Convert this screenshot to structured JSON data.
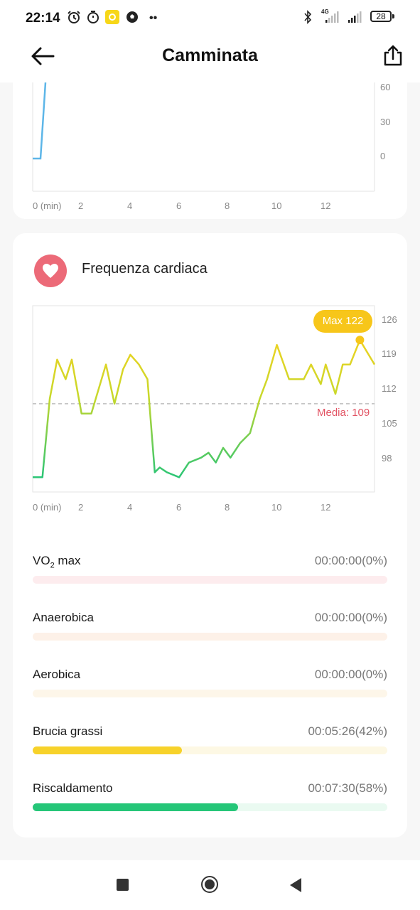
{
  "status_bar": {
    "time": "22:14",
    "battery": "28",
    "network": "4G",
    "icons": [
      "alarm-icon",
      "timer-icon",
      "app-notification-icon",
      "soccer-ball-icon",
      "more-dots-icon",
      "bluetooth-icon",
      "signal-icon",
      "battery-icon"
    ]
  },
  "header": {
    "title": "Camminata",
    "back_icon": "back-arrow-icon",
    "share_icon": "share-icon"
  },
  "top_chart": {
    "y_ticks": [
      "60",
      "30",
      "0"
    ],
    "x_ticks": [
      "0 (min)",
      "2",
      "4",
      "6",
      "8",
      "10",
      "12"
    ],
    "line_color": "#5db6e8"
  },
  "heart_rate": {
    "title": "Frequenza cardiaca",
    "max_label": "Max 122",
    "average_label": "Media: 109",
    "average": 109,
    "max": 122,
    "y_ticks": [
      "126",
      "119",
      "112",
      "105",
      "98"
    ],
    "x_ticks": [
      "0 (min)",
      "2",
      "4",
      "6",
      "8",
      "10",
      "12"
    ],
    "chart_data": {
      "type": "line",
      "xlabel": "min",
      "ylim": [
        91,
        129
      ],
      "xlim": [
        0,
        14
      ],
      "x": [
        0,
        0.4,
        0.7,
        1.0,
        1.35,
        1.6,
        2.0,
        2.4,
        3.0,
        3.35,
        3.7,
        4.0,
        4.35,
        4.7,
        5.0,
        5.2,
        5.5,
        6.0,
        6.4,
        6.9,
        7.2,
        7.5,
        7.8,
        8.1,
        8.5,
        8.9,
        9.3,
        9.6,
        10.0,
        10.5,
        10.8,
        11.1,
        11.4,
        11.8,
        12.0,
        12.4,
        12.7,
        13.0,
        13.4,
        14.0
      ],
      "y": [
        94,
        94,
        110,
        118,
        114,
        118,
        107,
        107,
        117,
        109,
        116,
        119,
        117,
        114,
        95,
        96,
        95,
        94,
        97,
        98,
        99,
        97,
        100,
        98,
        101,
        103,
        110,
        114,
        121,
        114,
        114,
        114,
        117,
        113,
        117,
        111,
        117,
        117,
        122,
        117,
        119
      ]
    }
  },
  "zones": [
    {
      "name": "VO₂ max",
      "value": "00:00:00(0%)",
      "fraction": 0.0,
      "fill": "#f06a7c",
      "track": "#fdecee"
    },
    {
      "name": "Anaerobica",
      "value": "00:00:00(0%)",
      "fraction": 0.0,
      "fill": "#f5a05a",
      "track": "#fdf1e8"
    },
    {
      "name": "Aerobica",
      "value": "00:00:00(0%)",
      "fraction": 0.0,
      "fill": "#f7c44a",
      "track": "#fdf6e9"
    },
    {
      "name": "Brucia grassi",
      "value": "00:05:26(42%)",
      "fraction": 0.42,
      "fill": "#f7d22a",
      "track": "#fdf8e4"
    },
    {
      "name": "Riscaldamento",
      "value": "00:07:30(58%)",
      "fraction": 0.58,
      "fill": "#25c678",
      "track": "#eafaf1"
    }
  ],
  "nav": {
    "icons": [
      "recents-square-icon",
      "home-circle-icon",
      "back-triangle-icon"
    ]
  }
}
